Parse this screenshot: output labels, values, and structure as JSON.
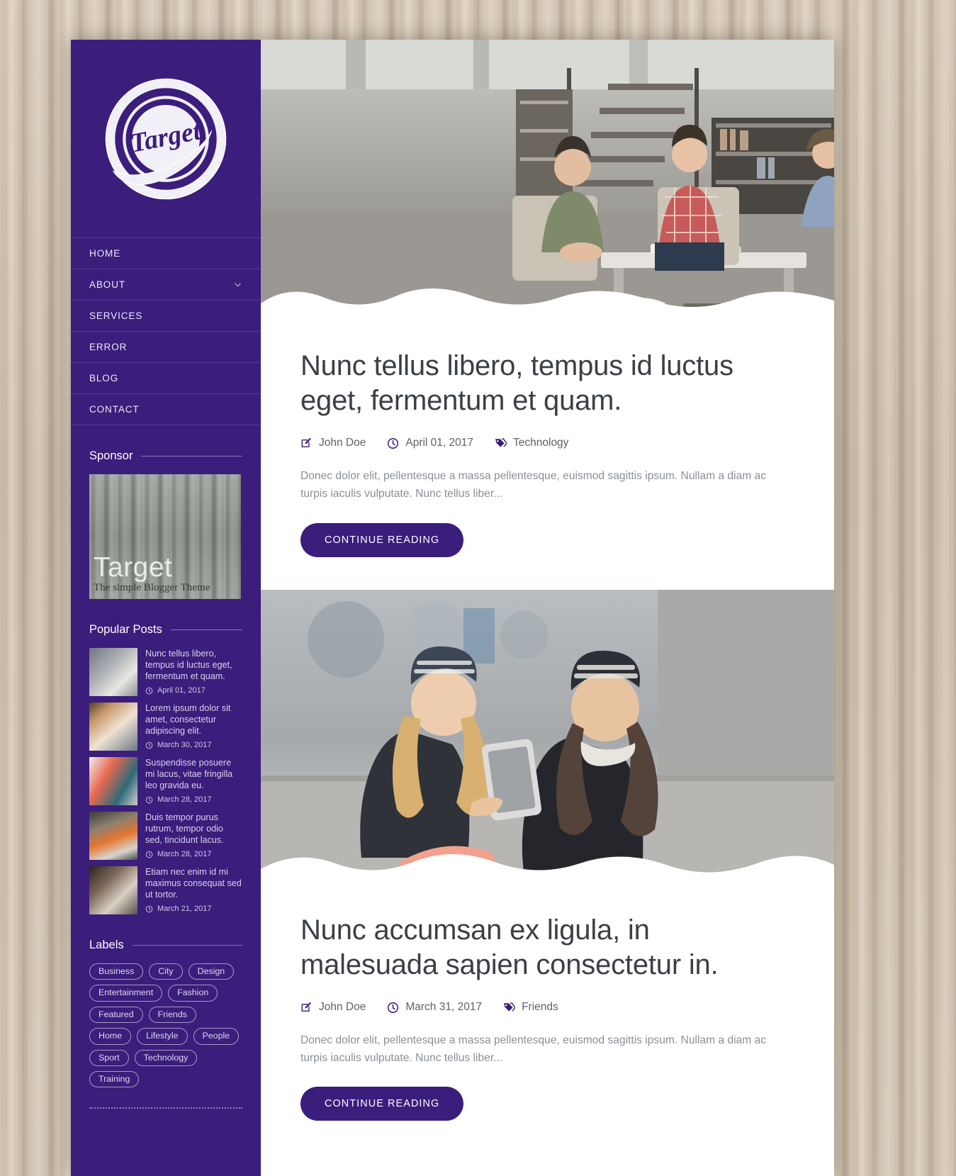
{
  "site": {
    "logo_text": "Target",
    "logo_icon": "target-circle-logo"
  },
  "nav": {
    "items": [
      {
        "label": "HOME",
        "has_submenu": false
      },
      {
        "label": "ABOUT",
        "has_submenu": true
      },
      {
        "label": "SERVICES",
        "has_submenu": false
      },
      {
        "label": "ERROR",
        "has_submenu": false
      },
      {
        "label": "BLOG",
        "has_submenu": false
      },
      {
        "label": "CONTACT",
        "has_submenu": false
      }
    ]
  },
  "sponsor": {
    "title": "Sponsor",
    "brand": "Target",
    "tagline": "The simple Blogger Theme"
  },
  "popular_posts": {
    "title": "Popular Posts",
    "items": [
      {
        "title": "Nunc tellus libero, tempus id luctus eget, fermentum et quam.",
        "date": "April 01, 2017"
      },
      {
        "title": "Lorem ipsum dolor sit amet, consectetur adipiscing elit.",
        "date": "March 30, 2017"
      },
      {
        "title": "Suspendisse posuere mi lacus, vitae fringilla leo gravida eu.",
        "date": "March 28, 2017"
      },
      {
        "title": "Duis tempor purus rutrum, tempor odio sed, tincidunt lacus.",
        "date": "March 28, 2017"
      },
      {
        "title": "Etiam nec enim id mi maximus consequat sed ut tortor.",
        "date": "March 21, 2017"
      }
    ]
  },
  "labels": {
    "title": "Labels",
    "items": [
      "Business",
      "City",
      "Design",
      "Entertainment",
      "Fashion",
      "Featured",
      "Friends",
      "Home",
      "Lifestyle",
      "People",
      "Sport",
      "Technology",
      "Training"
    ]
  },
  "posts": [
    {
      "title": "Nunc tellus libero, tempus id luctus eget, fermentum et quam.",
      "author": "John Doe",
      "date": "April 01, 2017",
      "category": "Technology",
      "excerpt": "Donec dolor elit, pellentesque a massa pellentesque, euismod sagittis ipsum. Nullam a diam ac turpis iaculis vulputate. Nunc tellus liber...",
      "button_label": "CONTINUE READING"
    },
    {
      "title": "Nunc accumsan ex ligula, in malesuada sapien consectetur in.",
      "author": "John Doe",
      "date": "March 31, 2017",
      "category": "Friends",
      "excerpt": "Donec dolor elit, pellentesque a massa pellentesque, euismod sagittis ipsum. Nullam a diam ac turpis iaculis vulputate. Nunc tellus liber...",
      "button_label": "CONTINUE READING"
    }
  ],
  "colors": {
    "brand_purple": "#3b1d7c",
    "page_bg": "#ffffff",
    "title_text": "#3b3f46",
    "muted_text": "#8b8f94"
  }
}
